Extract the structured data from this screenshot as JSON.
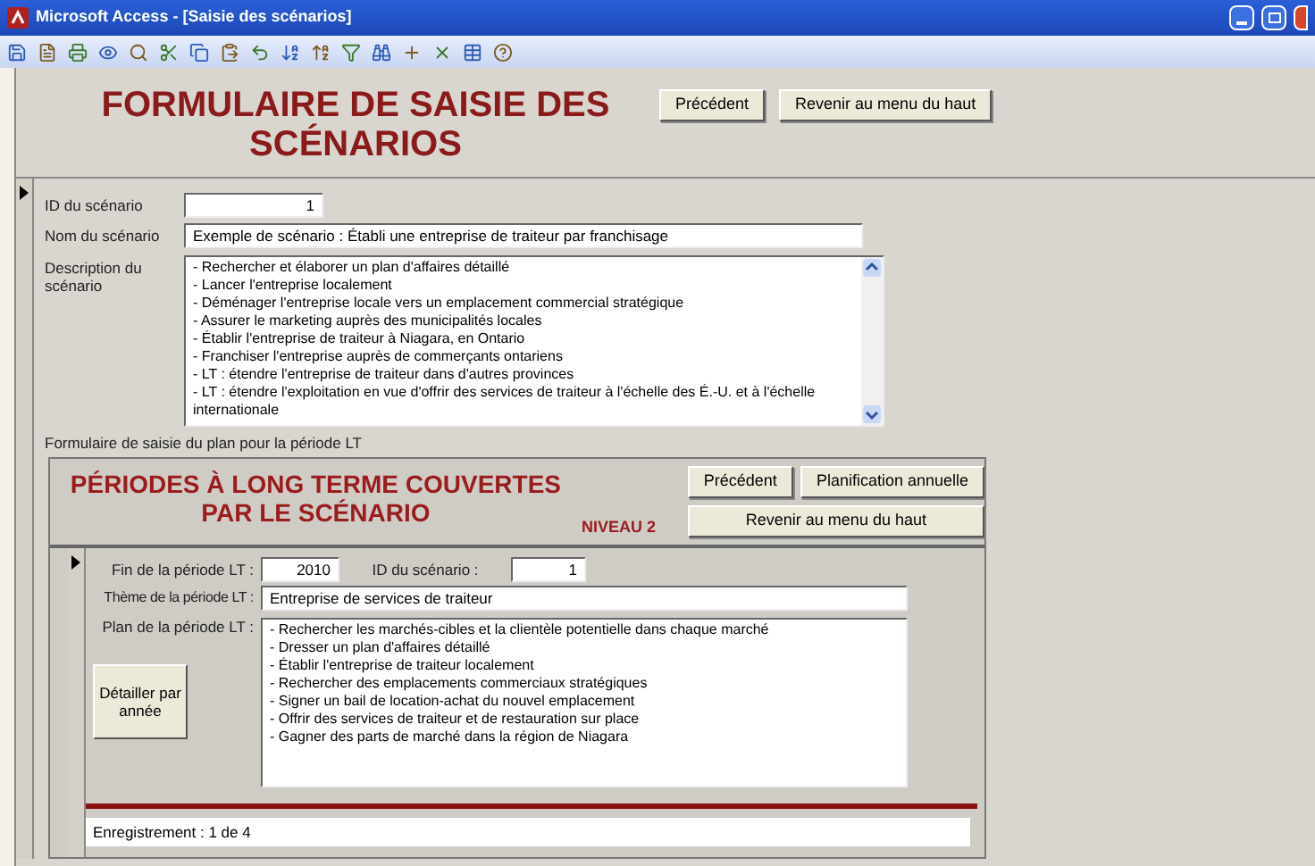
{
  "window": {
    "title": "Microsoft Access - [Saisie des scénarios]"
  },
  "header": {
    "title": "FORMULAIRE DE SAISIE DES SCÉNARIOS",
    "buttons": [
      "Précédent",
      "Revenir au menu du haut"
    ]
  },
  "record": {
    "current": true,
    "fields": [
      {
        "label": "ID du scénario",
        "kind": "number",
        "value": "1"
      },
      {
        "label": "Nom du scénario",
        "kind": "text",
        "value": "Exemple de scénario : Établi une entreprise de traiteur par franchisage"
      },
      {
        "label": "Description du scénario",
        "kind": "memo",
        "lines": [
          "- Rechercher et élaborer un plan d'affaires détaillé",
          "- Lancer l'entreprise localement",
          "- Déménager l'entreprise locale vers un emplacement commercial stratégique",
          "- Assurer le marketing auprès des municipalités locales",
          "- Établir l'entreprise de traiteur à Niagara, en Ontario",
          "- Franchiser l'entreprise auprès de commerçants ontariens",
          "- LT : étendre l'entreprise de traiteur dans d'autres provinces",
          "- LT : étendre l'exploitation en vue d'offrir des services de traiteur à l'échelle des É.-U. et à l'échelle",
          "internationale"
        ]
      }
    ]
  },
  "subform": {
    "label": "Formulaire de saisie du plan pour la période LT",
    "title": "PÉRIODES À LONG TERME COUVERTES PAR LE SCÉNARIO",
    "level": "NIVEAU 2",
    "buttons": [
      "Précédent",
      "Planification annuelle",
      "Revenir au menu du haut"
    ],
    "record": {
      "current": true,
      "end_label": "Fin de la période LT :",
      "end_value": "2010",
      "id_label": "ID du scénario :",
      "id_value": "1",
      "theme_label": "Thème de la période LT :",
      "theme_value": "Entreprise de services de traiteur",
      "plan_label": "Plan de la période LT :",
      "plan_lines": [
        "- Rechercher les marchés-cibles et la clientèle potentielle dans chaque marché",
        "- Dresser un plan d'affaires détaillé",
        "- Établir l'entreprise de traiteur localement",
        "- Rechercher des emplacements commerciaux stratégiques",
        "- Signer un bail de location-achat du nouvel emplacement",
        "- Offrir des services de traiteur et de restauration sur place",
        "- Gagner des parts de marché dans la région de Niagara"
      ],
      "detail_button": "Détailler par année"
    },
    "status": "Enregistrement : 1 de 4"
  }
}
